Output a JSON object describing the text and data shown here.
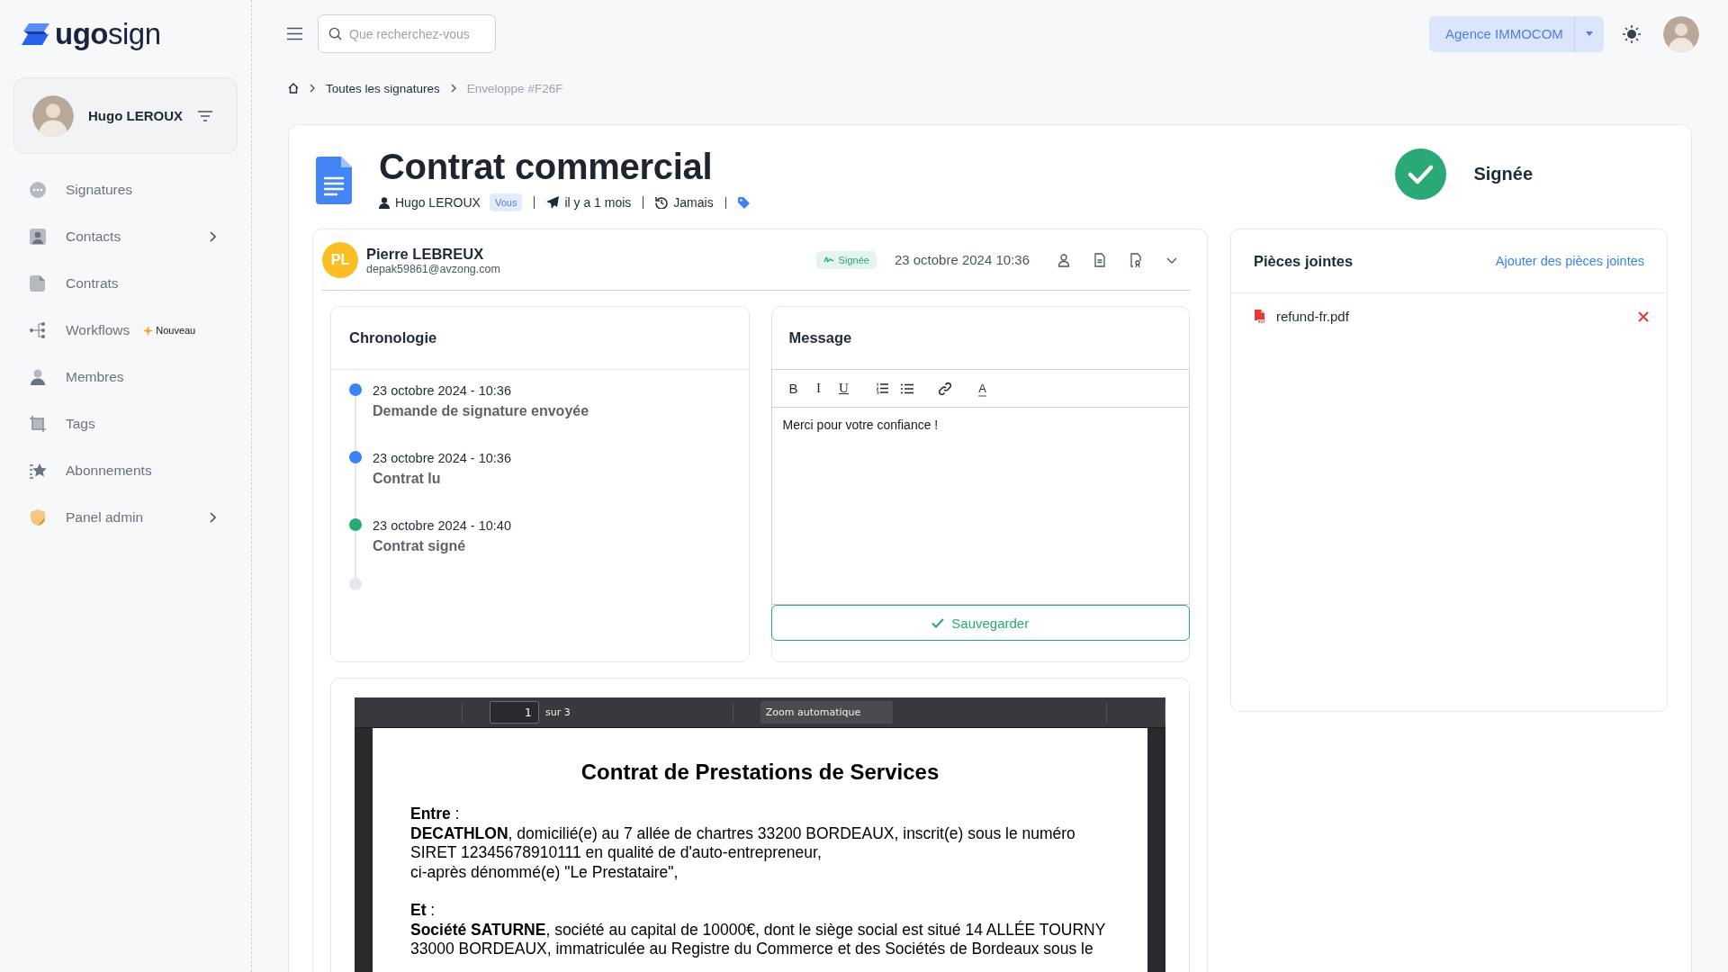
{
  "sidebar": {
    "logo": "**ugo**sign",
    "user": {
      "name": "Hugo LEROUX"
    },
    "items": [
      {
        "label": "Signatures",
        "selected": false,
        "expandable": false
      },
      {
        "label": "Contacts",
        "selected": false,
        "expandable": true
      },
      {
        "label": "Contrats",
        "selected": false,
        "expandable": false
      },
      {
        "label": "Workflows",
        "selected": false,
        "expandable": false,
        "badge": "Nouveau"
      },
      {
        "label": "Membres",
        "selected": false,
        "expandable": false
      },
      {
        "label": "Tags",
        "selected": false,
        "expandable": false
      },
      {
        "label": "Abonnements",
        "selected": false,
        "expandable": false
      },
      {
        "label": "Panel admin",
        "selected": false,
        "expandable": true
      }
    ]
  },
  "topbar": {
    "search": {
      "placeholder": "Que recherchez-vous"
    },
    "organization": "Agence IMMOCOM"
  },
  "breadcrumb": [
    {
      "label": "Toutes les signatures",
      "current": false
    },
    {
      "label": "Enveloppe #F26F",
      "current": true
    }
  ],
  "envelope": {
    "title": "Contrat commercial",
    "owner": "Hugo LEROUX",
    "owner_badge": "Vous",
    "sent": "il y a 1 mois",
    "reminder": "Jamais",
    "status": {
      "kind": "signed",
      "label": "Signée"
    }
  },
  "signer": {
    "initials": "PL",
    "name": "Pierre LEBREUX",
    "email": "depak59861@avzong.com",
    "status": "Signée",
    "date": "23 octobre 2024 10:36"
  },
  "timeline": {
    "title": "Chronologie",
    "events": [
      {
        "date": "23 octobre 2024 - 10:36",
        "label": "Demande de signature envoyée",
        "color": "#3b82f6"
      },
      {
        "date": "23 octobre 2024 - 10:36",
        "label": "Contrat lu",
        "color": "#3b82f6"
      },
      {
        "date": "23 octobre 2024 - 10:40",
        "label": "Contrat signé",
        "color": "#2aa876"
      }
    ]
  },
  "message": {
    "title": "Message",
    "toolbar": [
      {
        "kind": "bold",
        "label": "B"
      },
      {
        "kind": "italic",
        "label": "I"
      },
      {
        "kind": "underline",
        "label": "U"
      },
      {
        "kind": "ordered-list"
      },
      {
        "kind": "bullet-list"
      },
      {
        "kind": "link"
      },
      {
        "kind": "text-color",
        "label": "A"
      }
    ],
    "body": "Merci pour votre confiance !",
    "save": "Sauvegarder"
  },
  "document": {
    "page": "1",
    "page_count": "sur 3",
    "zoom": "Zoom automatique",
    "heading": "Contrat de Prestations de Services",
    "paragraphs": [
      {
        "kind": "label",
        "text": "**Entre** :"
      },
      {
        "kind": "text",
        "text": "**DECATHLON**, domicilié(e) au 7 allée de chartres 33200 BORDEAUX, inscrit(e) sous le numéro SIRET 12345678910111 en qualité de d'auto-entrepreneur,"
      },
      {
        "kind": "text",
        "text": "ci-après dénommé(e) \"Le Prestataire\","
      },
      {
        "kind": "label",
        "text": "**Et** :"
      },
      {
        "kind": "text",
        "text": "**Société SATURNE**, société au capital de 10000€, dont le siège social est situé 14 ALLÉE TOURNY 33000 BORDEAUX, immatriculée au Registre du Commerce et des Sociétés de Bordeaux sous le"
      }
    ]
  },
  "attachments": {
    "title": "Pièces jointes",
    "add": "Ajouter des pièces jointes",
    "files": [
      {
        "name": "refund-fr.pdf"
      }
    ]
  }
}
